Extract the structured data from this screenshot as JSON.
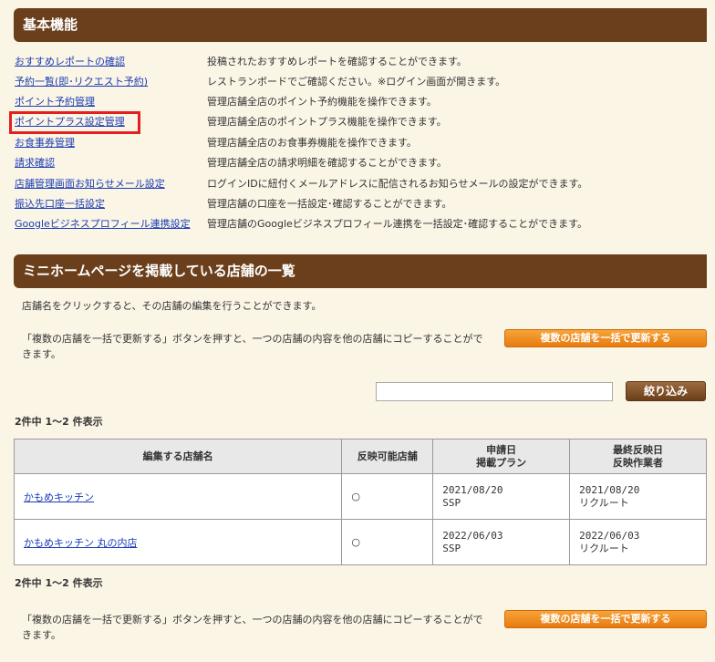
{
  "basic": {
    "title": "基本機能",
    "items": [
      {
        "link": "おすすめレポートの確認",
        "desc": "投稿されたおすすめレポートを確認することができます。"
      },
      {
        "link": "予約一覧(即･リクエスト予約)",
        "desc": "レストランボードでご確認ください。※ログイン画面が開きます。"
      },
      {
        "link": "ポイント予約管理",
        "desc": "管理店舗全店のポイント予約機能を操作できます。"
      },
      {
        "link": "ポイントプラス設定管理",
        "desc": "管理店舗全店のポイントプラス機能を操作できます。"
      },
      {
        "link": "お食事券管理",
        "desc": "管理店舗全店のお食事券機能を操作できます。"
      },
      {
        "link": "請求確認",
        "desc": "管理店舗全店の請求明細を確認することができます。"
      },
      {
        "link": "店舗管理画面お知らせメール設定",
        "desc": "ログインIDに紐付くメールアドレスに配信されるお知らせメールの設定ができます。"
      },
      {
        "link": "振込先口座一括設定",
        "desc": "管理店舗の口座を一括設定･確認することができます。"
      },
      {
        "link": "Googleビジネスプロフィール連携設定",
        "desc": "管理店舗のGoogleビジネスプロフィール連携を一括設定･確認することができます。"
      }
    ]
  },
  "mini": {
    "title": "ミニホームページを掲載している店舗の一覧",
    "intro": "店舗名をクリックすると、その店舗の編集を行うことができます。",
    "bulk_desc_line1": "「複数の店舗を一括で更新する」ボタンを押すと、一つの店舗の内容を他の店舗にコピーすることがで",
    "bulk_desc_line2": "きます。",
    "bulk_button": "複数の店舗を一括で更新する",
    "search_placeholder": "",
    "filter_button": "絞り込み",
    "count_text": "2件中 1〜2 件表示",
    "table": {
      "headers": {
        "name": "編集する店舗名",
        "reflect": "反映可能店舗",
        "applied_line1": "申請日",
        "applied_line2": "掲載プラン",
        "last_line1": "最終反映日",
        "last_line2": "反映作業者"
      },
      "rows": [
        {
          "name": "かもめキッチン",
          "mark": "○",
          "applied_date": "2021/08/20",
          "plan": "SSP",
          "last_date": "2021/08/20",
          "worker": "リクルート"
        },
        {
          "name": "かもめキッチン 丸の内店",
          "mark": "○",
          "applied_date": "2022/06/03",
          "plan": "SSP",
          "last_date": "2022/06/03",
          "worker": "リクルート"
        }
      ]
    }
  },
  "colors": {
    "header_bg": "#6b3f1b",
    "orange_button": "#f39020",
    "highlight": "#e32020",
    "link": "#1a3db5"
  }
}
